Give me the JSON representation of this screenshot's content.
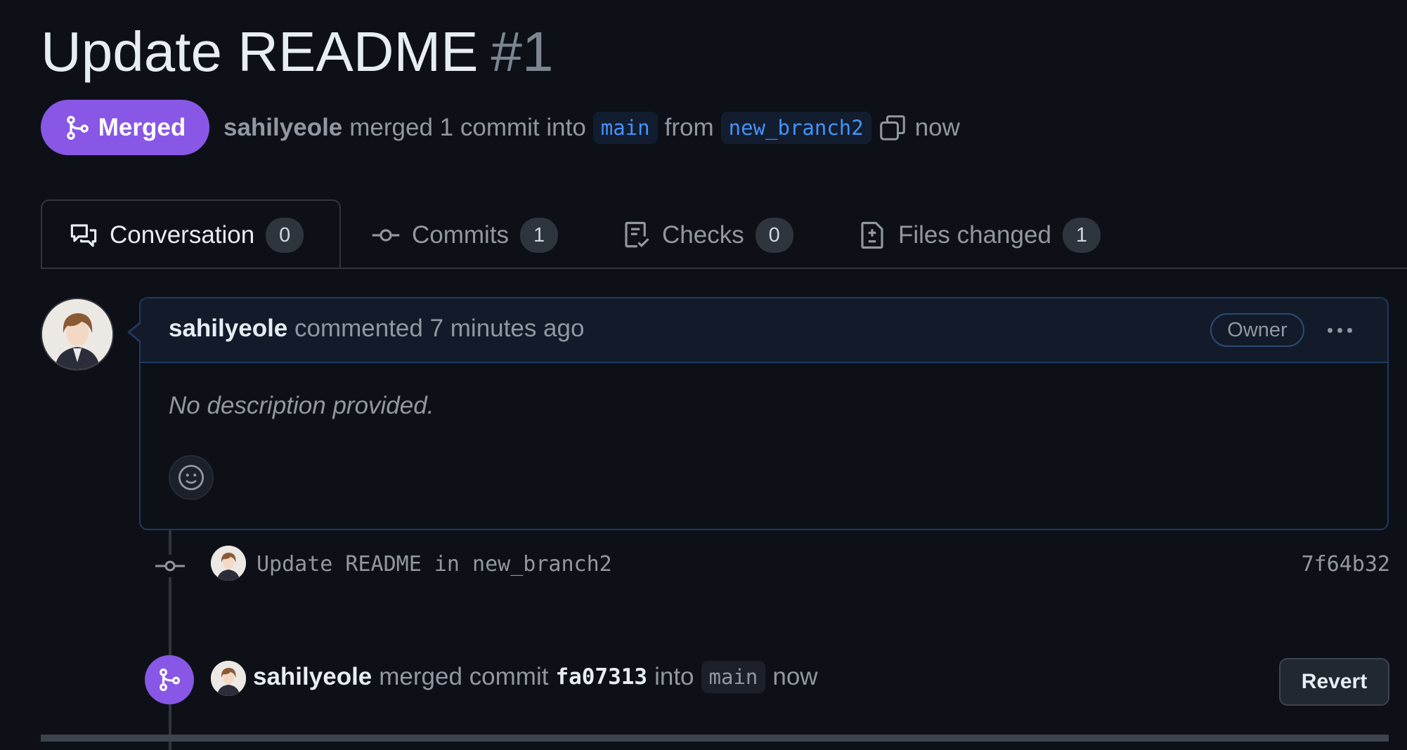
{
  "pr": {
    "title": "Update README",
    "number": "#1",
    "status_label": "Merged",
    "author": "sahilyeole",
    "merge_text": "merged 1 commit into",
    "base_branch": "main",
    "from_text": "from",
    "head_branch": "new_branch2",
    "time": "now"
  },
  "tabs": [
    {
      "label": "Conversation",
      "count": "0",
      "icon": "comment-discussion-icon",
      "active": true
    },
    {
      "label": "Commits",
      "count": "1",
      "icon": "git-commit-icon",
      "active": false
    },
    {
      "label": "Checks",
      "count": "0",
      "icon": "checklist-icon",
      "active": false
    },
    {
      "label": "Files changed",
      "count": "1",
      "icon": "file-diff-icon",
      "active": false
    }
  ],
  "comment": {
    "author": "sahilyeole",
    "action": "commented 7 minutes ago",
    "role_badge": "Owner",
    "body": "No description provided."
  },
  "timeline": {
    "commit": {
      "message": "Update README in new_branch2",
      "sha": "7f64b32"
    },
    "merge_event": {
      "author": "sahilyeole",
      "text": "merged commit",
      "sha": "fa07313",
      "into_text": "into",
      "branch": "main",
      "time": "now",
      "revert_label": "Revert"
    }
  },
  "colors": {
    "background": "#0d1117",
    "merged_purple": "#8957e5",
    "branch_blue": "#4493f8",
    "muted_text": "#9198a1"
  }
}
